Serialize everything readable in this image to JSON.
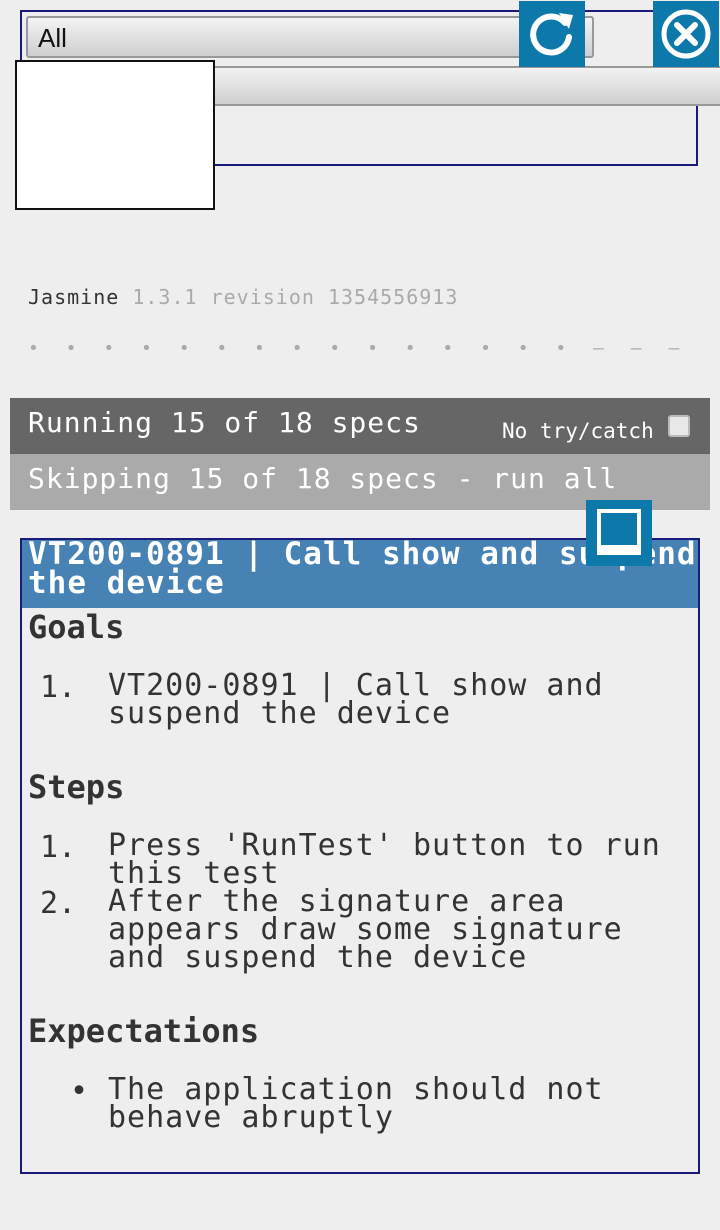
{
  "filter": {
    "selected": "All"
  },
  "jasmine": {
    "name": "Jasmine",
    "version": "1.3.1 revision 1354556913"
  },
  "progress": {
    "dots": "• • • • • • • • • • • • • • • – – –"
  },
  "runner": {
    "running": "Running 15 of 18 specs",
    "no_try_catch": "No try/catch",
    "skipping": "Skipping 15 of 18 specs - run all"
  },
  "spec": {
    "title": "VT200-0891 | Call show and suspend the device",
    "goals_heading": "Goals",
    "goals": [
      {
        "num": "1.",
        "text": "VT200-0891 | Call show and suspend the device"
      }
    ],
    "steps_heading": "Steps",
    "steps": [
      {
        "num": "1.",
        "text": "Press 'RunTest' button to run this test"
      },
      {
        "num": "2.",
        "text": "After the signature area appears draw some signature and suspend the device"
      }
    ],
    "expectations_heading": "Expectations",
    "expectations": [
      {
        "text": "The application should not behave abruptly"
      }
    ]
  },
  "icons": {
    "refresh": "refresh-icon",
    "close": "close-icon",
    "minimize": "minimize-icon"
  },
  "colors": {
    "accent": "#0d79aa",
    "header": "#4682b4",
    "running_bar": "#666666",
    "skipping_bar": "#aaaaaa"
  }
}
